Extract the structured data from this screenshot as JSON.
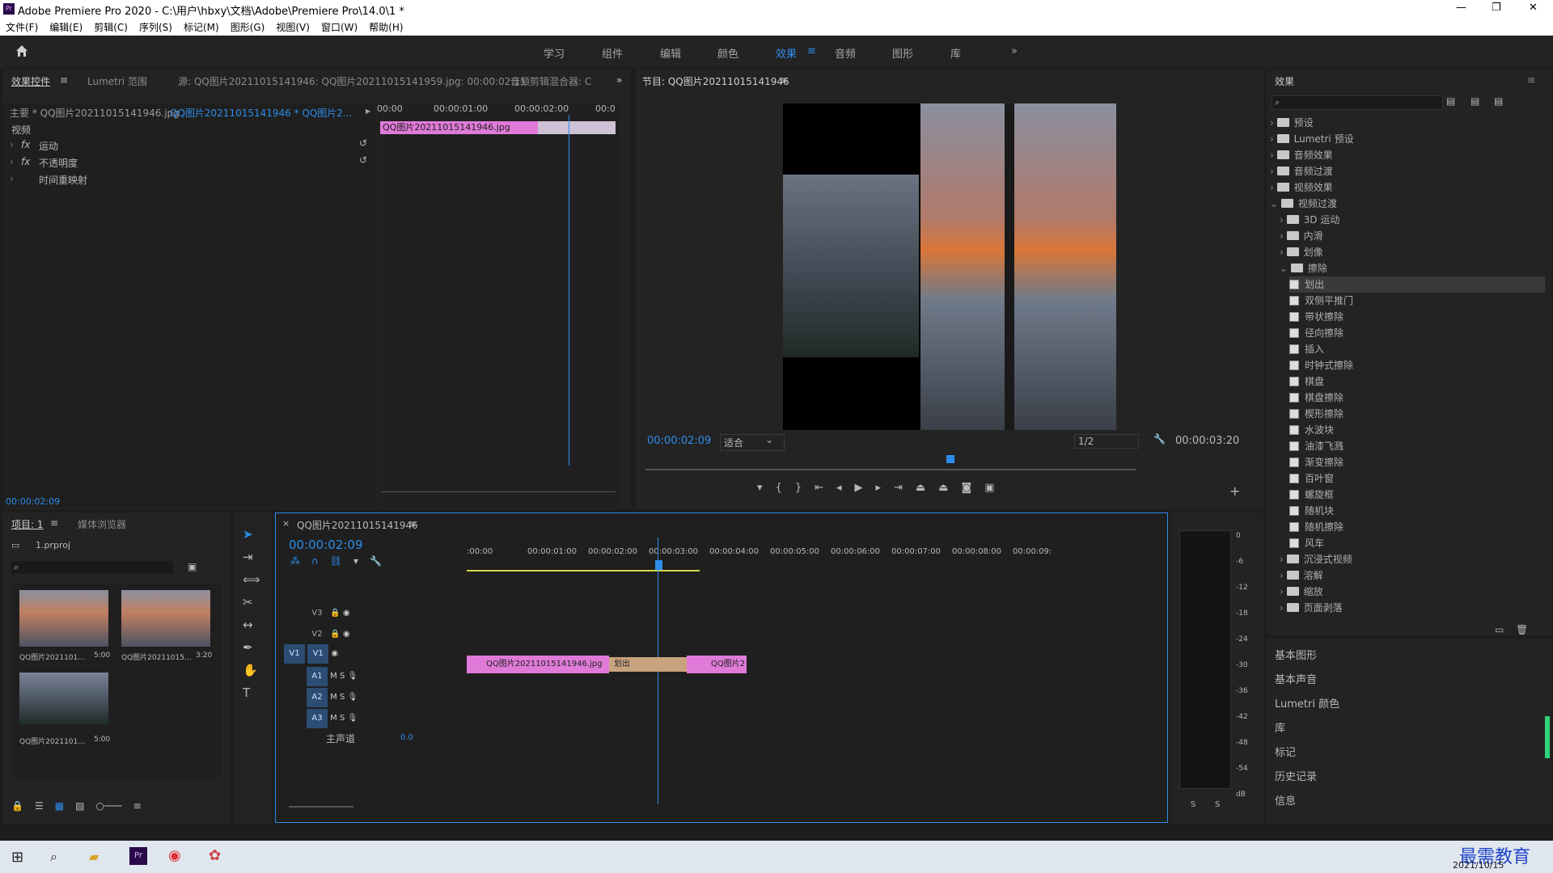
{
  "titlebar": {
    "app": "Adobe Premiere Pro 2020 - C:\\用户\\hbxy\\文档\\Adobe\\Premiere Pro\\14.0\\1 *",
    "min": "—",
    "max": "❐",
    "close": "✕"
  },
  "menu": [
    "文件(F)",
    "编辑(E)",
    "剪辑(C)",
    "序列(S)",
    "标记(M)",
    "图形(G)",
    "视图(V)",
    "窗口(W)",
    "帮助(H)"
  ],
  "workspaces": [
    "学习",
    "组件",
    "编辑",
    "颜色",
    "效果",
    "音频",
    "图形",
    "库"
  ],
  "workspace_active": "效果",
  "effect_controls": {
    "tab": "效果控件",
    "tab2": "Lumetri 范围",
    "tab3": "源: QQ图片20211015141946: QQ图片20211015141959.jpg: 00:00:02:11",
    "tab4": "音频剪辑混合器: C",
    "master": "主要 * QQ图片20211015141946.jpg",
    "clip": "QQ图片20211015141946 * QQ图片2...",
    "section": "视频",
    "rows": [
      "运动",
      "不透明度",
      "时间重映射"
    ],
    "ruler": [
      "00:00",
      "00:00:01:00",
      "00:00:02:00",
      "00:0"
    ],
    "clip_bar": "QQ图片20211015141946.jpg",
    "timecode": "00:00:02:09"
  },
  "program": {
    "title": "节目: QQ图片20211015141946",
    "timecode": "00:00:02:09",
    "fit": "适合",
    "quality": "1/2",
    "duration": "00:00:03:20"
  },
  "project": {
    "tab": "项目: 1",
    "tab2": "媒体浏览器",
    "file": "1.prproj",
    "items": [
      {
        "name": "QQ图片2021101...",
        "dur": "5:00"
      },
      {
        "name": "QQ图片20211015...",
        "dur": "3:20"
      },
      {
        "name": "QQ图片2021101...",
        "dur": "5:00"
      }
    ]
  },
  "timeline": {
    "title": "QQ图片20211015141946",
    "timecode": "00:00:02:09",
    "ruler": [
      ":00:00",
      "00:00:01:00",
      "00:00:02:00",
      "00:00:03:00",
      "00:00:04:00",
      "00:00:05:00",
      "00:00:06:00",
      "00:00:07:00",
      "00:00:08:00",
      "00:00:09:"
    ],
    "tracks_v": [
      "V3",
      "V2",
      "V1"
    ],
    "tracks_a": [
      "A1",
      "A2",
      "A3"
    ],
    "master": "主声道",
    "master_val": "0.0",
    "clip1": "QQ图片20211015141946.jpg",
    "transition": "划出",
    "clip2": "QQ图片2"
  },
  "meter": {
    "scale": [
      "0",
      "-6",
      "-12",
      "-18",
      "-24",
      "-30",
      "-36",
      "-42",
      "-48",
      "-54",
      "dB"
    ],
    "s1": "S",
    "s2": "S"
  },
  "effects": {
    "title": "效果",
    "tree": [
      {
        "t": "预设",
        "l": 0,
        "k": "folder"
      },
      {
        "t": "Lumetri 预设",
        "l": 0,
        "k": "folder"
      },
      {
        "t": "音频效果",
        "l": 0,
        "k": "folder"
      },
      {
        "t": "音频过渡",
        "l": 0,
        "k": "folder"
      },
      {
        "t": "视频效果",
        "l": 0,
        "k": "folder"
      },
      {
        "t": "视频过渡",
        "l": 0,
        "k": "folder"
      },
      {
        "t": "3D 运动",
        "l": 1,
        "k": "folder"
      },
      {
        "t": "内滑",
        "l": 1,
        "k": "folder"
      },
      {
        "t": "划像",
        "l": 1,
        "k": "folder"
      },
      {
        "t": "擦除",
        "l": 1,
        "k": "folder"
      },
      {
        "t": "划出",
        "l": 2,
        "k": "fx"
      },
      {
        "t": "双侧平推门",
        "l": 2,
        "k": "fx"
      },
      {
        "t": "带状擦除",
        "l": 2,
        "k": "fx"
      },
      {
        "t": "径向擦除",
        "l": 2,
        "k": "fx"
      },
      {
        "t": "插入",
        "l": 2,
        "k": "fx"
      },
      {
        "t": "时钟式擦除",
        "l": 2,
        "k": "fx"
      },
      {
        "t": "棋盘",
        "l": 2,
        "k": "fx"
      },
      {
        "t": "棋盘擦除",
        "l": 2,
        "k": "fx"
      },
      {
        "t": "楔形擦除",
        "l": 2,
        "k": "fx"
      },
      {
        "t": "水波块",
        "l": 2,
        "k": "fx"
      },
      {
        "t": "油漆飞溅",
        "l": 2,
        "k": "fx"
      },
      {
        "t": "渐变擦除",
        "l": 2,
        "k": "fx"
      },
      {
        "t": "百叶窗",
        "l": 2,
        "k": "fx"
      },
      {
        "t": "螺旋框",
        "l": 2,
        "k": "fx"
      },
      {
        "t": "随机块",
        "l": 2,
        "k": "fx"
      },
      {
        "t": "随机擦除",
        "l": 2,
        "k": "fx"
      },
      {
        "t": "风车",
        "l": 2,
        "k": "fx"
      },
      {
        "t": "沉浸式视频",
        "l": 1,
        "k": "folder"
      },
      {
        "t": "溶解",
        "l": 1,
        "k": "folder"
      },
      {
        "t": "缩放",
        "l": 1,
        "k": "folder"
      },
      {
        "t": "页面剥落",
        "l": 1,
        "k": "folder"
      }
    ],
    "sections": [
      "基本图形",
      "基本声音",
      "Lumetri 颜色",
      "库",
      "标记",
      "历史记录",
      "信息"
    ]
  },
  "taskbar": {
    "date": "2021/10/15",
    "watermark": "最需教育"
  },
  "colors": {
    "accent": "#2d8ceb",
    "clip": "#e07ad8",
    "panel": "#232323"
  }
}
